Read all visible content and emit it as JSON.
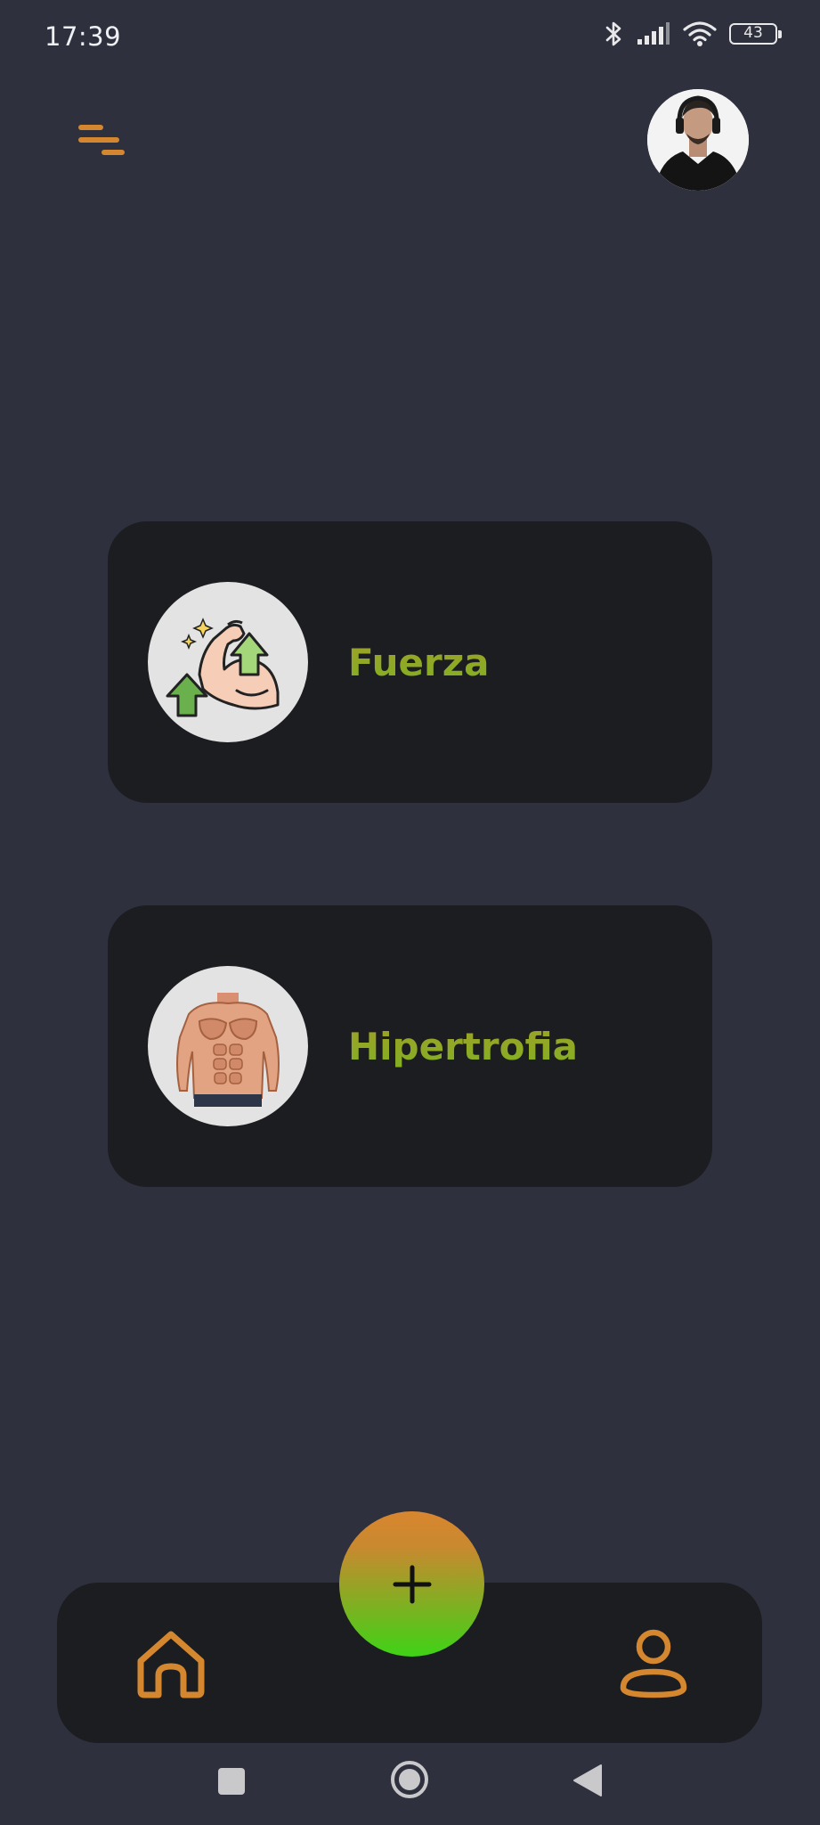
{
  "status_bar": {
    "time": "17:39",
    "battery": "43",
    "icons": [
      "bluetooth-icon",
      "signal-icon",
      "wifi-icon",
      "battery-icon"
    ]
  },
  "header": {
    "menu_icon": "menu-icon",
    "avatar": "profile-avatar"
  },
  "cards": [
    {
      "label": "Fuerza",
      "icon": "flexed-arm-growth-icon"
    },
    {
      "label": "Hipertrofia",
      "icon": "muscular-torso-icon"
    }
  ],
  "bottom_nav": {
    "home_icon": "home-icon",
    "add_icon": "plus-icon",
    "profile_icon": "user-icon"
  },
  "system_nav": [
    "recents-square-icon",
    "home-circle-icon",
    "back-triangle-icon"
  ],
  "colors": {
    "background": "#2e303d",
    "card": "#1c1d21",
    "accent_orange": "#d4872f",
    "accent_green": "#3ed316"
  }
}
